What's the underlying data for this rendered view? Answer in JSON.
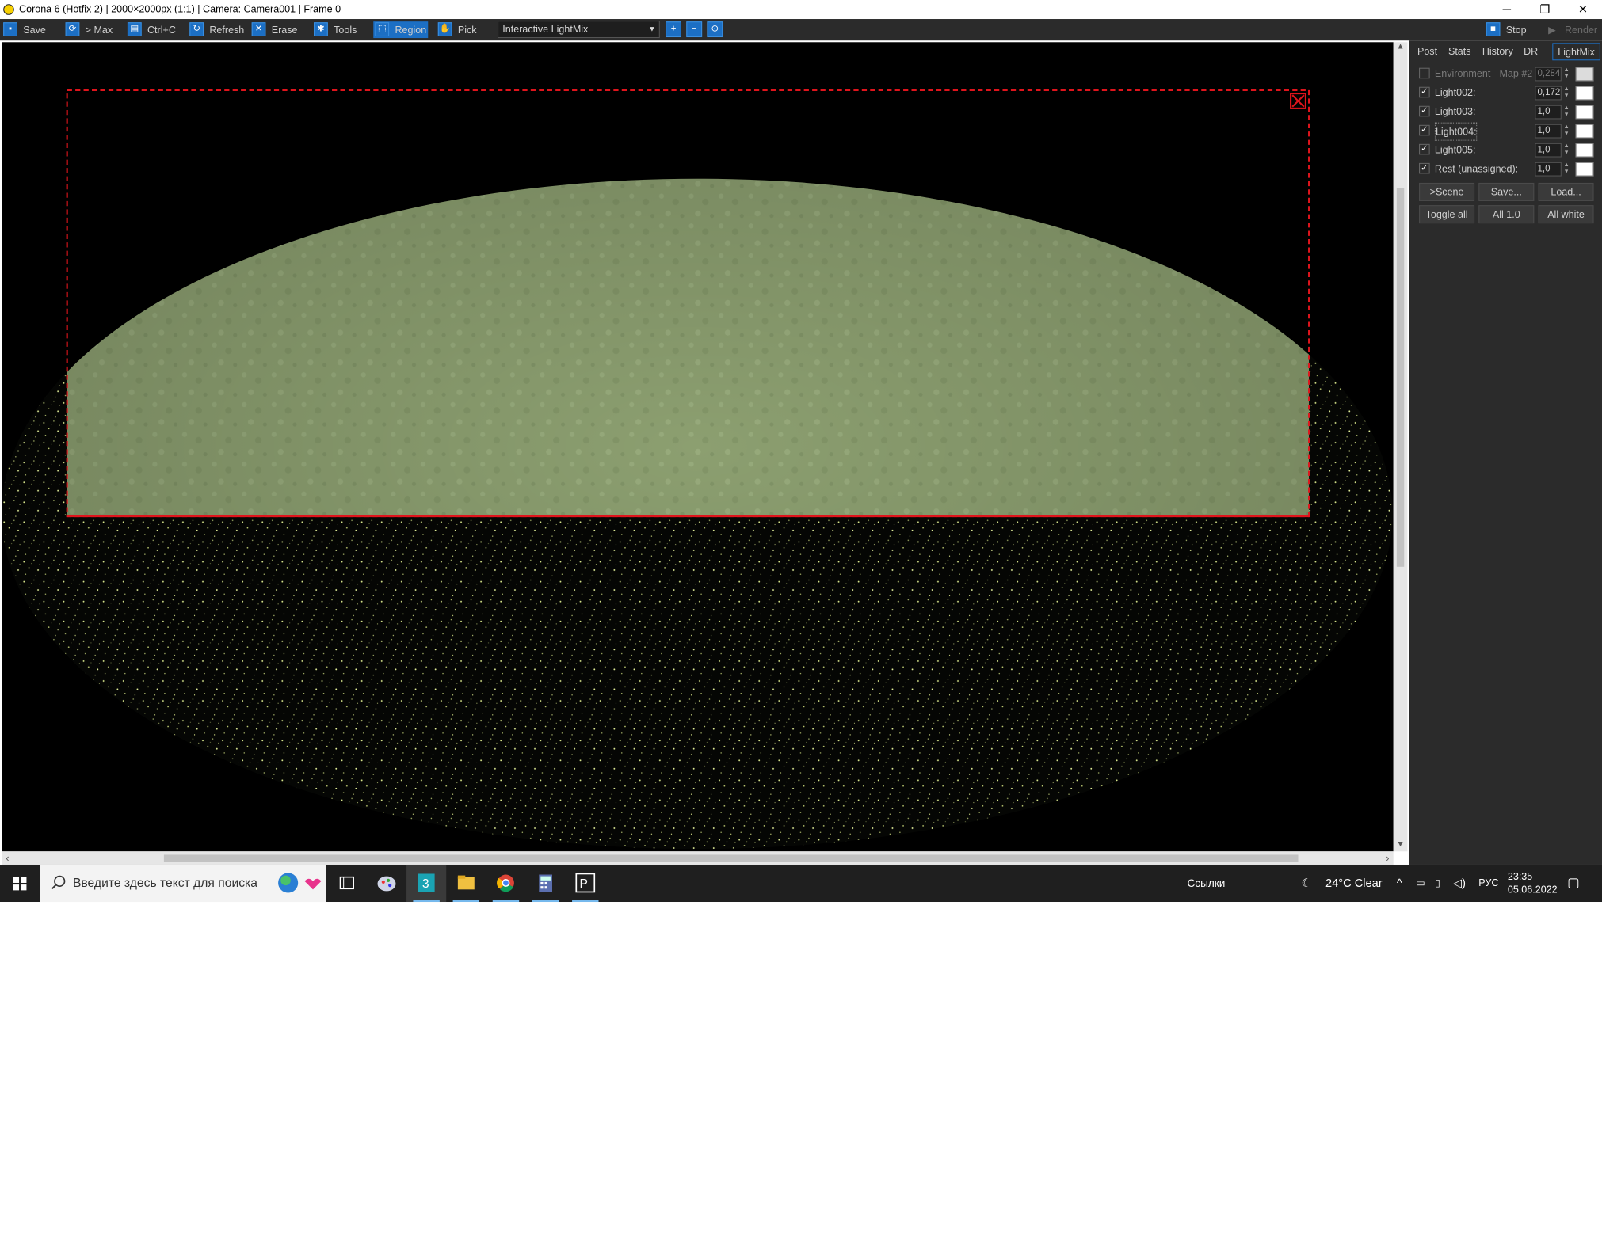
{
  "window": {
    "title": "Corona 6 (Hotfix 2) | 2000×2000px (1:1) | Camera: Camera001 | Frame 0",
    "minimize": "─",
    "restore": "❐",
    "close": "✕"
  },
  "toolbar": {
    "save": "Save",
    "to_max": "> Max",
    "copy": "Ctrl+C",
    "refresh": "Refresh",
    "erase": "Erase",
    "tools": "Tools",
    "region": "Region",
    "pick": "Pick",
    "mode_select": "Interactive LightMix",
    "stop": "Stop",
    "render": "Render"
  },
  "panel": {
    "tabs": [
      "Post",
      "Stats",
      "History",
      "DR",
      "LightMix"
    ],
    "active_tab": "LightMix",
    "lights": [
      {
        "name": "Environment - Map #2",
        "value": "0,284",
        "checked": false,
        "disabled": true
      },
      {
        "name": "Light002:",
        "value": "0,172",
        "checked": true,
        "disabled": false
      },
      {
        "name": "Light003:",
        "value": "1,0",
        "checked": true,
        "disabled": false
      },
      {
        "name": "Light004:",
        "value": "1,0",
        "checked": true,
        "disabled": false
      },
      {
        "name": "Light005:",
        "value": "1,0",
        "checked": true,
        "disabled": false
      },
      {
        "name": "Rest (unassigned):",
        "value": "1,0",
        "checked": true,
        "disabled": false
      }
    ],
    "buttons_row1": [
      ">Scene",
      "Save...",
      "Load..."
    ],
    "buttons_row2": [
      "Toggle all",
      "All 1.0",
      "All white"
    ]
  },
  "taskbar": {
    "search_placeholder": "Введите здесь текст для поиска",
    "links": "Ссылки",
    "weather": "24°C  Clear",
    "language": "РУС",
    "time": "23:35",
    "date": "05.06.2022"
  },
  "colors": {
    "accent": "#1c6fc4",
    "region_border": "#e0141c",
    "surface_green": "#8fa273",
    "panel_bg": "#2b2b2b"
  }
}
